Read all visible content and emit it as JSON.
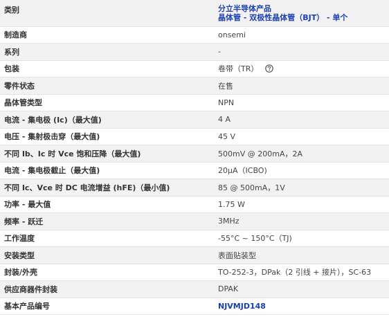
{
  "category": {
    "label": "类别",
    "line1": "分立半导体产品",
    "line2": "晶体管 - 双极性晶体管（BJT） - 单个"
  },
  "rows": [
    {
      "label": "制造商",
      "value": "onsemi"
    },
    {
      "label": "系列",
      "value": "-"
    },
    {
      "label": "包装",
      "value": "卷带（TR）"
    },
    {
      "label": "零件状态",
      "value": "在售"
    },
    {
      "label": "晶体管类型",
      "value": "NPN"
    },
    {
      "label": "电流 - 集电极 (Ic)（最大值)",
      "value": "4 A"
    },
    {
      "label": "电压 - 集射极击穿（最大值)",
      "value": "45 V"
    },
    {
      "label": "不同 Ib、Ic 时 Vce 饱和压降（最大值)",
      "value": "500mV @ 200mA，2A"
    },
    {
      "label": "电流 - 集电极截止（最大值)",
      "value": "20µA（ICBO)"
    },
    {
      "label": "不同 Ic、Vce 时 DC 电流增益 (hFE)（最小值)",
      "value": "85 @ 500mA，1V"
    },
    {
      "label": "功率 - 最大值",
      "value": "1.75 W"
    },
    {
      "label": "频率 - 跃迁",
      "value": "3MHz"
    },
    {
      "label": "工作温度",
      "value": "-55°C ~ 150°C（TJ)"
    },
    {
      "label": "安装类型",
      "value": "表面贴装型"
    },
    {
      "label": "封装/外壳",
      "value": "TO-252-3，DPak（2 引线 + 接片），SC-63"
    },
    {
      "label": "供应商器件封装",
      "value": "DPAK"
    },
    {
      "label": "基本产品编号",
      "value": "NJVMJD148"
    }
  ],
  "icons": {
    "packaging_help": "help-circle-icon"
  },
  "colors": {
    "link": "#1a3fb0",
    "stripe": "#f2f2f2",
    "border": "#e3e3e3"
  }
}
